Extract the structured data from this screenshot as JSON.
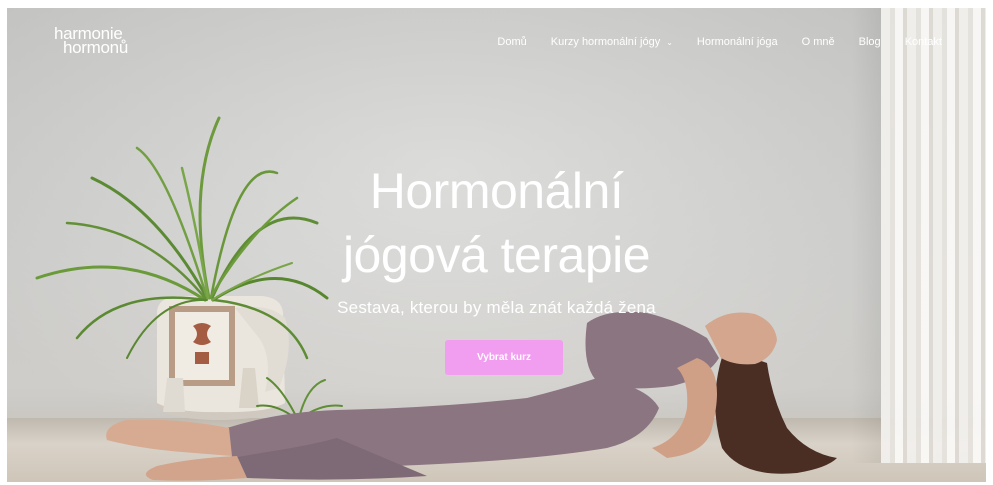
{
  "header": {
    "logo_line1": "harmonie",
    "logo_line2": "hormonů",
    "nav": [
      {
        "label": "Domů"
      },
      {
        "label": "Kurzy hormonální jógy",
        "has_dropdown": true
      },
      {
        "label": "Hormonální jóga"
      },
      {
        "label": "O mně"
      },
      {
        "label": "Blog"
      },
      {
        "label": "Kontakt"
      }
    ],
    "chevron_glyph": "⌄"
  },
  "hero": {
    "title_line1": "Hormonální",
    "title_line2": "jógová terapie",
    "subtitle": "Sestava, kterou by měla znát každá žena",
    "cta_label": "Vybrat kurz"
  },
  "colors": {
    "accent": "#f19df0",
    "text": "#ffffff",
    "wall": "#d4d4d2",
    "clothing": "#8a7580"
  }
}
